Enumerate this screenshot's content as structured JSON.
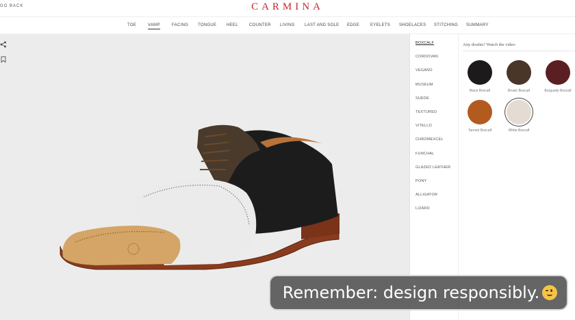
{
  "topbar": {
    "back_label": "GO BACK",
    "brand": "CARMINA"
  },
  "steps": [
    {
      "label": "TOE",
      "active": false
    },
    {
      "label": "VAMP",
      "active": true
    },
    {
      "label": "FACING",
      "active": false
    },
    {
      "label": "TONGUE",
      "active": false
    },
    {
      "label": "HEEL",
      "active": false
    },
    {
      "label": "COUNTER",
      "active": false
    },
    {
      "label": "LIVING",
      "active": false
    },
    {
      "label": "LAST AND SOLE",
      "active": false
    },
    {
      "label": "EDGE",
      "active": false
    },
    {
      "label": "EYELETS",
      "active": false
    },
    {
      "label": "SHOELACES",
      "active": false
    },
    {
      "label": "STITCHING",
      "active": false
    },
    {
      "label": "SUMMARY",
      "active": false
    }
  ],
  "side_icons": [
    "share-icon",
    "bookmark-icon"
  ],
  "materials": [
    {
      "label": "BOXCALF",
      "active": true
    },
    {
      "label": "CORDOVAN",
      "active": false
    },
    {
      "label": "VEGANO",
      "active": false
    },
    {
      "label": "MUSEUM",
      "active": false
    },
    {
      "label": "SUEDE",
      "active": false
    },
    {
      "label": "TEXTURED",
      "active": false
    },
    {
      "label": "VITELLO",
      "active": false
    },
    {
      "label": "CHROMEXCEL",
      "active": false
    },
    {
      "label": "FUNCHAL",
      "active": false
    },
    {
      "label": "GLAZED LEATHER",
      "active": false
    },
    {
      "label": "PONY",
      "active": false
    },
    {
      "label": "ALLIGATOR",
      "active": false
    },
    {
      "label": "LIZARD",
      "active": false
    }
  ],
  "colors_panel": {
    "help_text": "Any doubts? Watch the video",
    "swatches": [
      {
        "label": "Black Boxcalf",
        "color": "#1c1a1a",
        "selected": false
      },
      {
        "label": "Brown Boxcalf",
        "color": "#4a3529",
        "selected": false
      },
      {
        "label": "Burgundy Boxcalf",
        "color": "#5a1f22",
        "selected": false
      },
      {
        "label": "Tanned Boxcalf",
        "color": "#b35a1f",
        "selected": false
      },
      {
        "label": "White Boxcalf",
        "color": "#e4dcd3",
        "selected": true
      }
    ]
  },
  "toast": {
    "text": "Remember: design responsibly."
  },
  "shoe": {
    "toe_color": "#d4a566",
    "vamp_color": "#ebebeb",
    "quarter_color": "#1c1c1c",
    "facing_color": "#4a3a2c",
    "sole_color": "#8a3b1e",
    "lining_color": "#b8733a"
  }
}
